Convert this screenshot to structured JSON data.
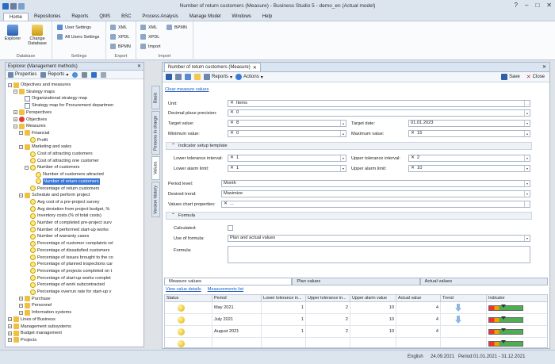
{
  "window": {
    "title": "Number of return customers (Measure) - Business Studio 5 - demo_en (Actual model)"
  },
  "menu": {
    "tabs": [
      "Home",
      "Repositories",
      "Reports",
      "QMS",
      "BSC",
      "Process Analysis",
      "Manage Model",
      "Windows",
      "Help"
    ]
  },
  "ribbon": {
    "database": {
      "label": "Database",
      "explorer": "Explorer",
      "change_db": "Change Database"
    },
    "settings": {
      "label": "Settings",
      "user": "User Settings",
      "all_users": "All Users Settings"
    },
    "export": {
      "label": "Export",
      "xml": "XML",
      "xpdl": "XPDL",
      "bpmn": "BPMN"
    },
    "import": {
      "label": "Import",
      "xml": "XML",
      "xpdl": "XPDL",
      "import": "Import",
      "bpmn": "BPMN"
    }
  },
  "explorer": {
    "title": "Explorer (Management methods)",
    "toolbar": {
      "properties": "Properties",
      "reports": "Reports"
    },
    "tree": [
      "Objectives and measures",
      "Strategy maps",
      "Organizational strategy map",
      "Strategy map for Procurement departmen",
      "Perspectives",
      "Objectives",
      "Measures",
      "Financial",
      "Profit",
      "Marketing and sales",
      "Cost of attracting customers",
      "Cost of attracting one customer",
      "Number of customers",
      "Number of customers attracted",
      "Number of return customers",
      "Percentage of return customers",
      "Schedule and perform project",
      "Avg cost of a pre-project survey",
      "Avg deviation from project budget, %",
      "Inventory costs (% of total costs)",
      "Number of completed pre-project surv",
      "Number of performed start-up works",
      "Number of warranty cases",
      "Percentage of customer complaints rel",
      "Percentage of dissatisfied customers",
      "Percentage of issues brought to the co",
      "Percentage of planned inspections car",
      "Percentage of projects completed on t",
      "Percentage of start-up works complet",
      "Percentage of work subcontracted",
      "Percentage overrun rate for start-up v",
      "Purchase",
      "Personnel",
      "Information systems",
      "Lines of Business",
      "Management subsystems",
      "Budget management",
      "Projects"
    ]
  },
  "sidetabs": [
    "Basic",
    "Persons in charge",
    "Values",
    "Version history"
  ],
  "doc": {
    "tab": "Number of return customers (Measure)",
    "toolbar": {
      "reports": "Reports",
      "actions": "Actions",
      "save": "Save",
      "close": "Close"
    },
    "clear_link": "Clear measure values",
    "fields": {
      "unit_l": "Unit:",
      "unit_v": "Items",
      "dec_l": "Decimal place precision:",
      "dec_v": "0",
      "target_l": "Target value:",
      "target_v": "8",
      "tdate_l": "Target date:",
      "tdate_v": "01.01.2023",
      "min_l": "Minimum value:",
      "min_v": "0",
      "max_l": "Maximum value:",
      "max_v": "15",
      "tmpl_sect": "Indicator setup template",
      "ltol_l": "Lower tolerance interval:",
      "ltol_v": "1",
      "utol_l": "Upper tolerance interval:",
      "utol_v": "2",
      "lal_l": "Lower alarm limit:",
      "lal_v": "1",
      "ual_l": "Upper alarm limit:",
      "ual_v": "10",
      "period_l": "Period level:",
      "period_v": "Month",
      "trend_l": "Desired trend:",
      "trend_v": "Maximize",
      "vcp_l": "Values chart properties:",
      "vcp_v": "...",
      "formula_sect": "Formula",
      "calc_l": "Calculated:",
      "use_l": "Use of formula:",
      "use_v": "Plan and actual values",
      "formula_l": "Formula:"
    },
    "value_tabs": [
      "Measure values",
      "Plan values",
      "Actual values"
    ],
    "links": [
      "View value details",
      "Measurements list"
    ],
    "grid": {
      "headers": [
        "Status",
        "Period",
        "Lower tolerance in...",
        "Upper tolerance in...",
        "Upper alarm value",
        "Actual value",
        "Trend",
        "Indicator"
      ],
      "rows": [
        {
          "period": "May 2021",
          "lti": "1",
          "uti": "2",
          "uav": "10",
          "av": "4",
          "trend": "down",
          "indicator": 0.42
        },
        {
          "period": "July 2021",
          "lti": "1",
          "uti": "2",
          "uav": "10",
          "av": "4",
          "trend": "down",
          "indicator": 0.42
        },
        {
          "period": "August 2021",
          "lti": "1",
          "uti": "2",
          "uav": "10",
          "av": "4",
          "trend": "",
          "indicator": 0.42
        },
        {
          "period": "",
          "lti": "",
          "uti": "",
          "uav": "",
          "av": "",
          "trend": "",
          "indicator": 0.42
        }
      ]
    }
  },
  "status": {
    "lang": "English",
    "date": "24.09.2021",
    "period": "Period:01.01.2021 - 31.12.2021"
  },
  "colors": {
    "accent": "#3875d7",
    "ribbon_bg": "#fafbfd",
    "chrome": "#dce4ee"
  }
}
